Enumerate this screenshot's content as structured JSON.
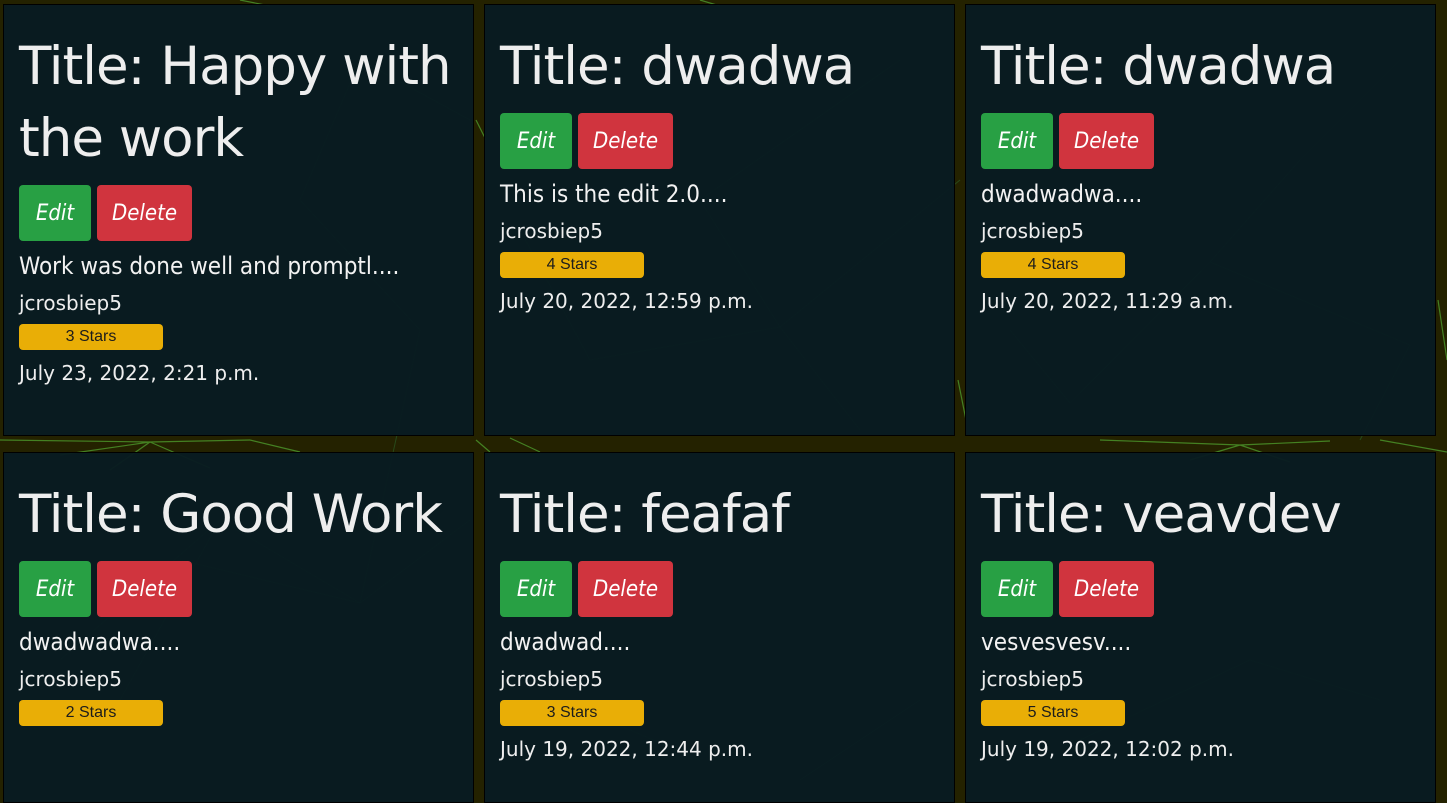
{
  "cards": [
    {
      "title": "Title: Happy with the work",
      "edit_label": "Edit",
      "delete_label": "Delete",
      "text": "Work was done well and promptl....",
      "author": "jcrosbiep5",
      "stars": "3 Stars",
      "date": "July 23, 2022, 2:21 p.m."
    },
    {
      "title": "Title: dwadwa",
      "edit_label": "Edit",
      "delete_label": "Delete",
      "text": "This is the edit 2.0....",
      "author": "jcrosbiep5",
      "stars": "4 Stars",
      "date": "July 20, 2022, 12:59 p.m."
    },
    {
      "title": "Title: dwadwa",
      "edit_label": "Edit",
      "delete_label": "Delete",
      "text": "dwadwadwa....",
      "author": "jcrosbiep5",
      "stars": "4 Stars",
      "date": "July 20, 2022, 11:29 a.m."
    },
    {
      "title": "Title: Good Work",
      "edit_label": "Edit",
      "delete_label": "Delete",
      "text": "dwadwadwa....",
      "author": "jcrosbiep5",
      "stars": "2 Stars",
      "date": ""
    },
    {
      "title": "Title: feafaf",
      "edit_label": "Edit",
      "delete_label": "Delete",
      "text": "dwadwad....",
      "author": "jcrosbiep5",
      "stars": "3 Stars",
      "date": "July 19, 2022, 12:44 p.m."
    },
    {
      "title": "Title: veavdev",
      "edit_label": "Edit",
      "delete_label": "Delete",
      "text": "vesvesvesv....",
      "author": "jcrosbiep5",
      "stars": "5 Stars",
      "date": "July 19, 2022, 12:02 p.m."
    }
  ],
  "colors": {
    "page_background": "#242200",
    "card_background": "#081b21",
    "edit_button": "#28a044",
    "delete_button": "#d0343e",
    "stars_badge": "#e9ae06",
    "network_lines": "#6fd84a"
  }
}
